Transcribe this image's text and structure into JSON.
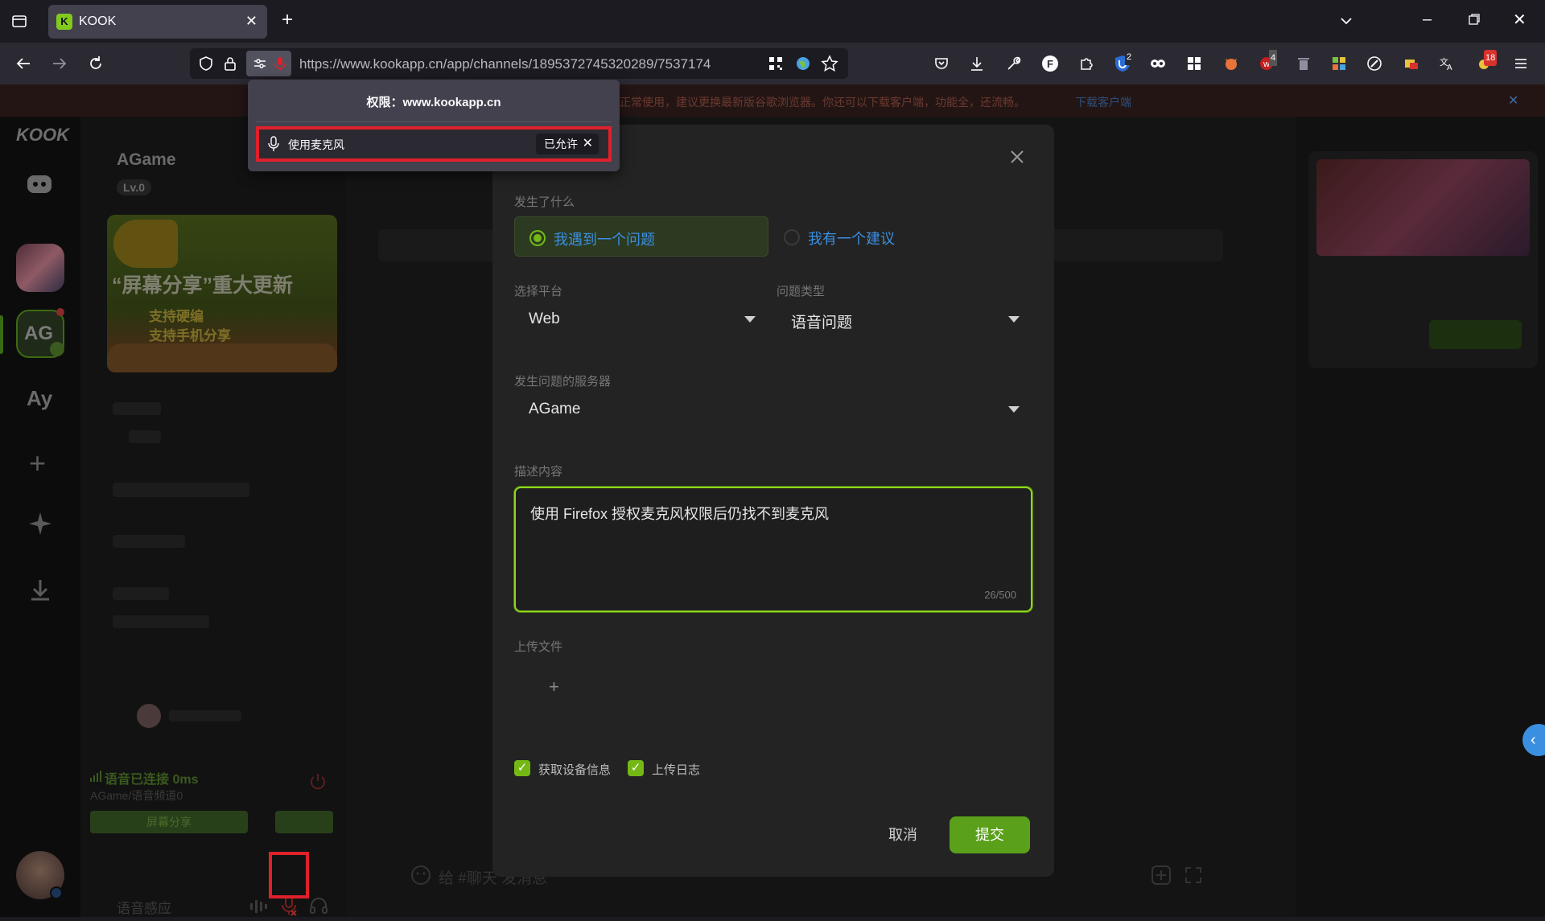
{
  "browser": {
    "tab_title": "KOOK",
    "tab_favicon_letter": "K",
    "url": "https://www.kookapp.cn/app/channels/1895372745320289/7537174",
    "badges": {
      "ublock": "2",
      "ext_a": "4",
      "ext_b": "18"
    }
  },
  "permission_popup": {
    "title": "权限：www.kookapp.cn",
    "mic_label": "使用麦克风",
    "state": "已允许"
  },
  "notice": {
    "text": "正常使用，建议更换最新版谷歌浏览器。你还可以下载客户端，功能全，还流畅。",
    "link": "下载客户端"
  },
  "rail": {
    "logo": "KOOK",
    "server_ag": "AG",
    "server_ay": "Ay"
  },
  "guild": {
    "name": "AGame",
    "level": "Lv.0",
    "banner_title": "“屏幕分享”重大更新",
    "banner_line1": "支持硬编",
    "banner_line2": "支持手机分享",
    "voice_status": "语音已连接 0ms",
    "voice_channel": "AGame/语音频道0",
    "screen_share": "屏幕分享",
    "voice_mode": "语音感应"
  },
  "chat": {
    "input_placeholder": "给 #聊天 发消息"
  },
  "modal": {
    "what_happened_label": "发生了什么",
    "option_problem": "我遇到一个问题",
    "option_suggestion": "我有一个建议",
    "platform_label": "选择平台",
    "platform_value": "Web",
    "issue_type_label": "问题类型",
    "issue_type_value": "语音问题",
    "server_label": "发生问题的服务器",
    "server_value": "AGame",
    "description_label": "描述内容",
    "description_value": "使用 Firefox 授权麦克风权限后仍找不到麦克风",
    "description_count": "26/500",
    "upload_label": "上传文件",
    "upload_plus": "+",
    "check_device": "获取设备信息",
    "check_log": "上传日志",
    "cancel": "取消",
    "submit": "提交"
  },
  "colors": {
    "accent_green": "#74b816",
    "highlight_red": "#e0202a",
    "link_blue": "#3b8fe0"
  }
}
